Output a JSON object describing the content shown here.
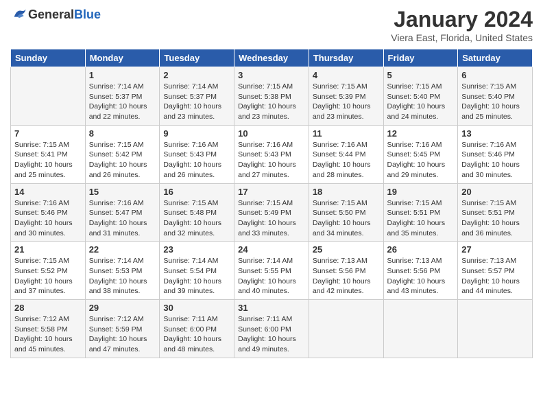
{
  "logo": {
    "general": "General",
    "blue": "Blue"
  },
  "header": {
    "month_year": "January 2024",
    "location": "Viera East, Florida, United States"
  },
  "days_of_week": [
    "Sunday",
    "Monday",
    "Tuesday",
    "Wednesday",
    "Thursday",
    "Friday",
    "Saturday"
  ],
  "weeks": [
    [
      {
        "num": "",
        "detail": ""
      },
      {
        "num": "1",
        "detail": "Sunrise: 7:14 AM\nSunset: 5:37 PM\nDaylight: 10 hours\nand 22 minutes."
      },
      {
        "num": "2",
        "detail": "Sunrise: 7:14 AM\nSunset: 5:37 PM\nDaylight: 10 hours\nand 23 minutes."
      },
      {
        "num": "3",
        "detail": "Sunrise: 7:15 AM\nSunset: 5:38 PM\nDaylight: 10 hours\nand 23 minutes."
      },
      {
        "num": "4",
        "detail": "Sunrise: 7:15 AM\nSunset: 5:39 PM\nDaylight: 10 hours\nand 23 minutes."
      },
      {
        "num": "5",
        "detail": "Sunrise: 7:15 AM\nSunset: 5:40 PM\nDaylight: 10 hours\nand 24 minutes."
      },
      {
        "num": "6",
        "detail": "Sunrise: 7:15 AM\nSunset: 5:40 PM\nDaylight: 10 hours\nand 25 minutes."
      }
    ],
    [
      {
        "num": "7",
        "detail": "Sunrise: 7:15 AM\nSunset: 5:41 PM\nDaylight: 10 hours\nand 25 minutes."
      },
      {
        "num": "8",
        "detail": "Sunrise: 7:15 AM\nSunset: 5:42 PM\nDaylight: 10 hours\nand 26 minutes."
      },
      {
        "num": "9",
        "detail": "Sunrise: 7:16 AM\nSunset: 5:43 PM\nDaylight: 10 hours\nand 26 minutes."
      },
      {
        "num": "10",
        "detail": "Sunrise: 7:16 AM\nSunset: 5:43 PM\nDaylight: 10 hours\nand 27 minutes."
      },
      {
        "num": "11",
        "detail": "Sunrise: 7:16 AM\nSunset: 5:44 PM\nDaylight: 10 hours\nand 28 minutes."
      },
      {
        "num": "12",
        "detail": "Sunrise: 7:16 AM\nSunset: 5:45 PM\nDaylight: 10 hours\nand 29 minutes."
      },
      {
        "num": "13",
        "detail": "Sunrise: 7:16 AM\nSunset: 5:46 PM\nDaylight: 10 hours\nand 30 minutes."
      }
    ],
    [
      {
        "num": "14",
        "detail": "Sunrise: 7:16 AM\nSunset: 5:46 PM\nDaylight: 10 hours\nand 30 minutes."
      },
      {
        "num": "15",
        "detail": "Sunrise: 7:16 AM\nSunset: 5:47 PM\nDaylight: 10 hours\nand 31 minutes."
      },
      {
        "num": "16",
        "detail": "Sunrise: 7:15 AM\nSunset: 5:48 PM\nDaylight: 10 hours\nand 32 minutes."
      },
      {
        "num": "17",
        "detail": "Sunrise: 7:15 AM\nSunset: 5:49 PM\nDaylight: 10 hours\nand 33 minutes."
      },
      {
        "num": "18",
        "detail": "Sunrise: 7:15 AM\nSunset: 5:50 PM\nDaylight: 10 hours\nand 34 minutes."
      },
      {
        "num": "19",
        "detail": "Sunrise: 7:15 AM\nSunset: 5:51 PM\nDaylight: 10 hours\nand 35 minutes."
      },
      {
        "num": "20",
        "detail": "Sunrise: 7:15 AM\nSunset: 5:51 PM\nDaylight: 10 hours\nand 36 minutes."
      }
    ],
    [
      {
        "num": "21",
        "detail": "Sunrise: 7:15 AM\nSunset: 5:52 PM\nDaylight: 10 hours\nand 37 minutes."
      },
      {
        "num": "22",
        "detail": "Sunrise: 7:14 AM\nSunset: 5:53 PM\nDaylight: 10 hours\nand 38 minutes."
      },
      {
        "num": "23",
        "detail": "Sunrise: 7:14 AM\nSunset: 5:54 PM\nDaylight: 10 hours\nand 39 minutes."
      },
      {
        "num": "24",
        "detail": "Sunrise: 7:14 AM\nSunset: 5:55 PM\nDaylight: 10 hours\nand 40 minutes."
      },
      {
        "num": "25",
        "detail": "Sunrise: 7:13 AM\nSunset: 5:56 PM\nDaylight: 10 hours\nand 42 minutes."
      },
      {
        "num": "26",
        "detail": "Sunrise: 7:13 AM\nSunset: 5:56 PM\nDaylight: 10 hours\nand 43 minutes."
      },
      {
        "num": "27",
        "detail": "Sunrise: 7:13 AM\nSunset: 5:57 PM\nDaylight: 10 hours\nand 44 minutes."
      }
    ],
    [
      {
        "num": "28",
        "detail": "Sunrise: 7:12 AM\nSunset: 5:58 PM\nDaylight: 10 hours\nand 45 minutes."
      },
      {
        "num": "29",
        "detail": "Sunrise: 7:12 AM\nSunset: 5:59 PM\nDaylight: 10 hours\nand 47 minutes."
      },
      {
        "num": "30",
        "detail": "Sunrise: 7:11 AM\nSunset: 6:00 PM\nDaylight: 10 hours\nand 48 minutes."
      },
      {
        "num": "31",
        "detail": "Sunrise: 7:11 AM\nSunset: 6:00 PM\nDaylight: 10 hours\nand 49 minutes."
      },
      {
        "num": "",
        "detail": ""
      },
      {
        "num": "",
        "detail": ""
      },
      {
        "num": "",
        "detail": ""
      }
    ]
  ]
}
